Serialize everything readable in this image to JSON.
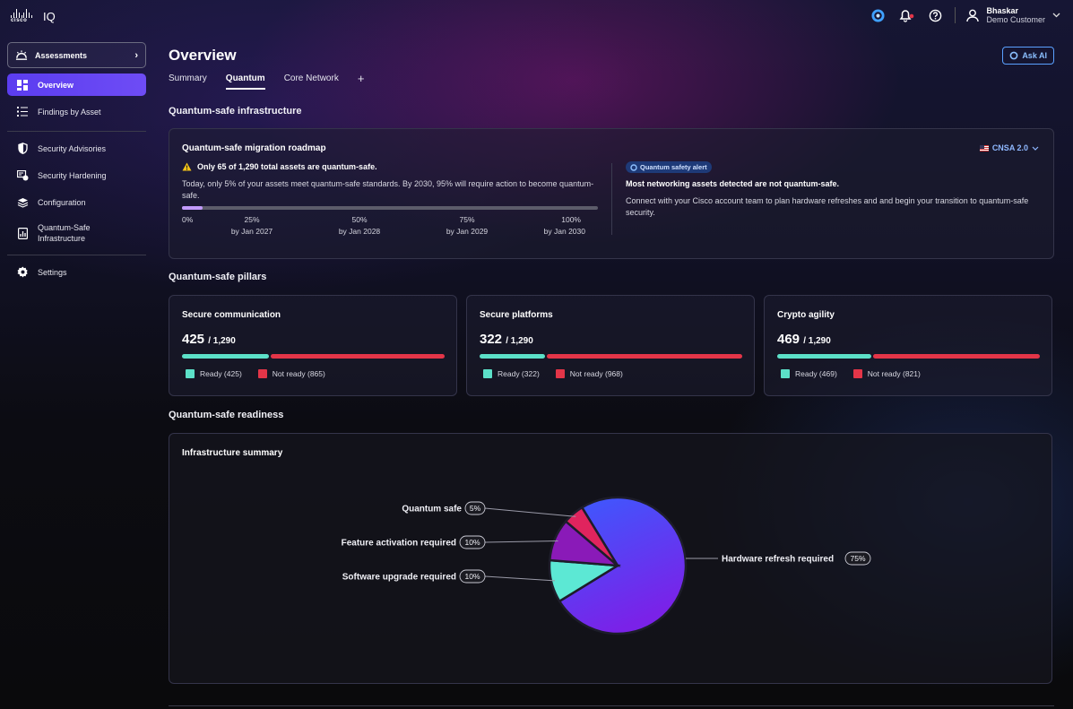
{
  "app": {
    "logo_text": "cisco",
    "product": "IQ"
  },
  "header": {
    "user_name": "Bhaskar",
    "user_org": "Demo Customer"
  },
  "sidebar": {
    "assessments_label": "Assessments",
    "items": [
      {
        "label": "Overview",
        "icon": "dashboard-icon",
        "active": true
      },
      {
        "label": "Findings by Asset",
        "icon": "list-icon"
      },
      {
        "label": "Security Advisories",
        "icon": "shield-icon"
      },
      {
        "label": "Security Hardening",
        "icon": "hardening-icon"
      },
      {
        "label": "Configuration",
        "icon": "layers-icon"
      },
      {
        "label": "Quantum-Safe",
        "label2": "Infrastructure",
        "icon": "report-icon"
      },
      {
        "label": "Settings",
        "icon": "gear-icon"
      }
    ]
  },
  "main": {
    "title": "Overview",
    "ask_ai": "Ask AI",
    "tabs": [
      "Summary",
      "Quantum",
      "Core Network"
    ],
    "active_tab": "Quantum",
    "tab_add": "+"
  },
  "infrastructure": {
    "section_title": "Quantum-safe infrastructure",
    "card_title": "Quantum-safe migration roadmap",
    "standard": "CNSA 2.0",
    "warning": "Only 65 of 1,290 total assets are quantum-safe.",
    "description": "Today, only 5% of your assets meet quantum-safe standards. By 2030, 95% will require action to become quantum-safe.",
    "progress": 0.05,
    "milestones": [
      {
        "pct": "0%",
        "date": ""
      },
      {
        "pct": "25%",
        "date": "by Jan 2027"
      },
      {
        "pct": "50%",
        "date": "by Jan 2028"
      },
      {
        "pct": "75%",
        "date": "by Jan 2029"
      },
      {
        "pct": "100%",
        "date": "by Jan 2030"
      }
    ],
    "alert_pill": "Quantum safety alert",
    "alert_title": "Most networking assets detected are not quantum-safe.",
    "alert_desc": "Connect with your Cisco account team to plan hardware refreshes and and begin your transition to quantum-safe security."
  },
  "pillars": {
    "section_title": "Quantum-safe pillars",
    "items": [
      {
        "title": "Secure communication",
        "ready": 425,
        "total": "/ 1,290",
        "ready_label": "Ready (425)",
        "not_label": "Not ready (865)",
        "ready_frac": 0.33
      },
      {
        "title": "Secure platforms",
        "ready": 322,
        "total": "/ 1,290",
        "ready_label": "Ready (322)",
        "not_label": "Not ready (968)",
        "ready_frac": 0.25
      },
      {
        "title": "Crypto agility",
        "ready": 469,
        "total": "/ 1,290",
        "ready_label": "Ready (469)",
        "not_label": "Not ready (821)",
        "ready_frac": 0.36
      }
    ],
    "colors": {
      "ready": "#5ce0c8",
      "not_ready": "#e33548"
    }
  },
  "readiness": {
    "section_title": "Quantum-safe readiness",
    "card_title": "Infrastructure summary"
  },
  "chart_data": {
    "type": "pie",
    "title": "Infrastructure summary",
    "slices": [
      {
        "label": "Hardware refresh required",
        "value": 75,
        "display": "75%",
        "color": "#4a44f0"
      },
      {
        "label": "Software upgrade required",
        "value": 10,
        "display": "10%",
        "color": "#5ce8d4"
      },
      {
        "label": "Feature activation required",
        "value": 10,
        "display": "10%",
        "color": "#8a1ab8"
      },
      {
        "label": "Quantum safe",
        "value": 5,
        "display": "5%",
        "color": "#e0245e"
      }
    ]
  }
}
